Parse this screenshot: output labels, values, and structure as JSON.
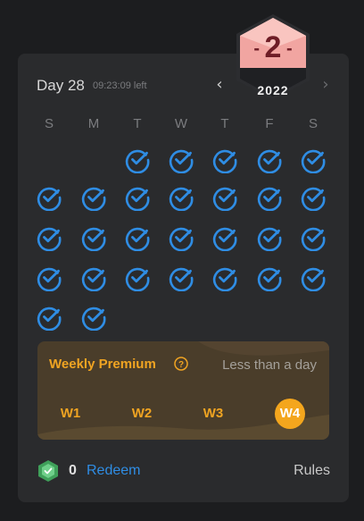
{
  "badge": {
    "number": "2",
    "year": "2022"
  },
  "header": {
    "day_label": "Day 28",
    "time_left": "09:23:09 left",
    "prev_symbol": "‹",
    "next_symbol": "›"
  },
  "calendar": {
    "weekdays": [
      "S",
      "M",
      "T",
      "W",
      "T",
      "F",
      "S"
    ],
    "first_weekday_index": 2,
    "checked_days": 28,
    "check_color": "#2f8de4"
  },
  "premium": {
    "title": "Weekly Premium",
    "status": "Less than a day",
    "weeks": [
      "W1",
      "W2",
      "W3",
      "W4"
    ],
    "active_week": "W4",
    "accent_color": "#f0a422"
  },
  "footer": {
    "gem_count": "0",
    "redeem_label": "Redeem",
    "rules_label": "Rules"
  }
}
